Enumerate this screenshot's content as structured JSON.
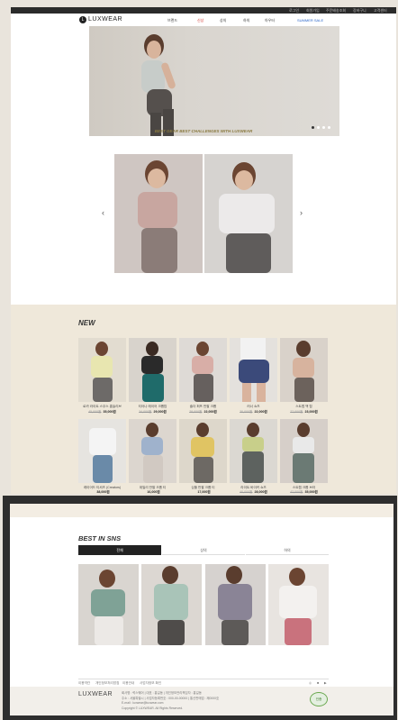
{
  "topbar": {
    "links": [
      "로그인",
      "회원가입",
      "주문배송조회",
      "장바구니",
      "고객센터"
    ]
  },
  "brand": {
    "name": "LUXWEAR",
    "mark": "L"
  },
  "nav": {
    "items": [
      {
        "label": "브랜드",
        "color": "#333333"
      },
      {
        "label": "신상",
        "color": "#d2342d"
      },
      {
        "label": "상의",
        "color": "#333333"
      },
      {
        "label": "하의",
        "color": "#333333"
      },
      {
        "label": "아우터",
        "color": "#333333"
      },
      {
        "label": "SUMMER SALE",
        "color": "#2b66c9"
      }
    ]
  },
  "hero": {
    "dots": 4,
    "active_dot": 1
  },
  "tagline": "BEST GEAR BEST CHALLENGES WITH LUXWEAR",
  "carousel": {
    "prev": "‹",
    "next": "›"
  },
  "new_section": {
    "title": "NEW",
    "products": [
      {
        "name": "로카 라이트 스무스 롱슬리브",
        "old": "45,000원",
        "price": "35,000원"
      },
      {
        "name": "티아나 레이어 크롭탑",
        "old": "34,000원",
        "price": "29,000원"
      },
      {
        "name": "숄더 퍼프 반팔 크롭",
        "old": "28,000원",
        "price": "22,000원"
      },
      {
        "name": "러너 쇼츠",
        "old": "30,000원",
        "price": "22,000원"
      },
      {
        "name": "스트랩 백 탑",
        "old": "27,000원",
        "price": "23,000원"
      },
      {
        "name": "레이어드 티셔츠 (Creators)",
        "old": "",
        "price": "38,000원"
      },
      {
        "name": "데일리 반팔 크롭 티",
        "old": "",
        "price": "16,000원"
      },
      {
        "name": "심플 반팔 크롭 티",
        "old": "",
        "price": "17,000원"
      },
      {
        "name": "라이트 바이커 쇼츠",
        "old": "40,000원",
        "price": "28,000원"
      },
      {
        "name": "스트랩 크롭 브라",
        "old": "42,000원",
        "price": "35,000원"
      }
    ]
  },
  "sns_section": {
    "title": "BEST IN SNS",
    "tabs": [
      "전체",
      "상의",
      "하의"
    ],
    "active_tab": 0
  },
  "footer": {
    "links": [
      "이용약관",
      "개인정보처리방침",
      "이용안내",
      "사업자정보 확인"
    ],
    "logo": "LUXWEAR",
    "lines": [
      "회사명 : 럭스웨어 | 대표 : 홍길동 | 개인정보관리책임자 : 홍길동",
      "주소 : 서울특별시 | 사업자등록번호 : 000-00-00000 | 통신판매업 : 제0000호",
      "E-mail : luxwear@luxwear.com",
      "Copyright © LUXWEAR. All Rights Reserved."
    ],
    "badge": "인증"
  },
  "colors": {
    "accent": "#8a7a40",
    "beige": "#efe8da",
    "dark": "#2e2e2e"
  }
}
